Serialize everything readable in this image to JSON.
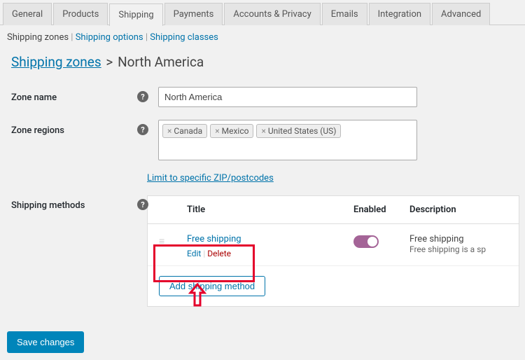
{
  "tabs": {
    "general": "General",
    "products": "Products",
    "shipping": "Shipping",
    "payments": "Payments",
    "accounts": "Accounts & Privacy",
    "emails": "Emails",
    "integration": "Integration",
    "advanced": "Advanced"
  },
  "subnav": {
    "zones": "Shipping zones",
    "options": "Shipping options",
    "classes": "Shipping classes"
  },
  "breadcrumb": {
    "root": "Shipping zones",
    "sep": ">",
    "current": "North America"
  },
  "form": {
    "zone_name_label": "Zone name",
    "zone_name_value": "North America",
    "zone_regions_label": "Zone regions",
    "regions": {
      "r0": "Canada",
      "r1": "Mexico",
      "r2": "United States (US)"
    },
    "limit_link": "Limit to specific ZIP/postcodes",
    "methods_label": "Shipping methods"
  },
  "methods": {
    "head_title": "Title",
    "head_enabled": "Enabled",
    "head_desc": "Description",
    "row": {
      "title": "Free shipping",
      "edit": "Edit",
      "delete": "Delete",
      "desc_title": "Free shipping",
      "desc_sub": "Free shipping is a sp"
    },
    "add_btn": "Add shipping method"
  },
  "save_btn": "Save changes"
}
